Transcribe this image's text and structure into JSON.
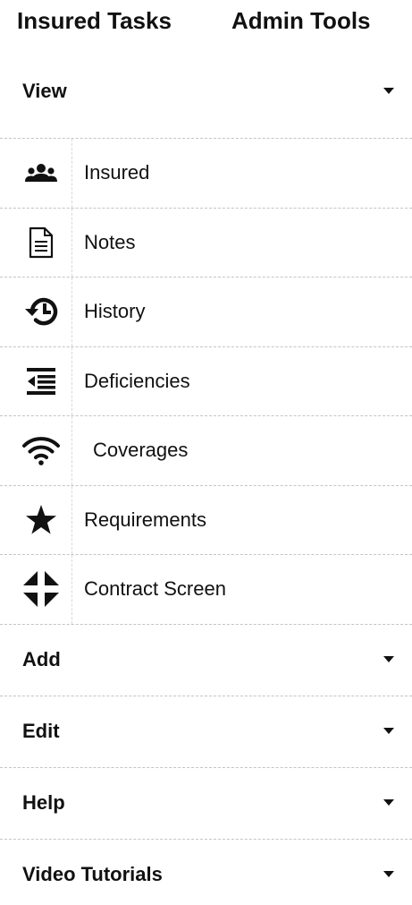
{
  "header": {
    "insured_tab": "Insured Tasks",
    "admin_tab": "Admin Tools"
  },
  "sections": {
    "view": {
      "label": "View",
      "expanded": true
    },
    "add": {
      "label": "Add",
      "expanded": false
    },
    "edit": {
      "label": "Edit",
      "expanded": false
    },
    "help": {
      "label": "Help",
      "expanded": false
    },
    "video": {
      "label": "Video Tutorials",
      "expanded": false
    }
  },
  "view_items": [
    {
      "label": "Insured",
      "icon": "users-icon"
    },
    {
      "label": "Notes",
      "icon": "document-icon"
    },
    {
      "label": "History",
      "icon": "history-icon"
    },
    {
      "label": "Deficiencies",
      "icon": "outdent-list-icon"
    },
    {
      "label": "Coverages",
      "icon": "wifi-icon"
    },
    {
      "label": "Requirements",
      "icon": "star-icon"
    },
    {
      "label": "Contract Screen",
      "icon": "compress-arrows-icon"
    }
  ],
  "colors": {
    "text": "#111111",
    "divider": "#c4c4c4",
    "background": "#ffffff"
  }
}
